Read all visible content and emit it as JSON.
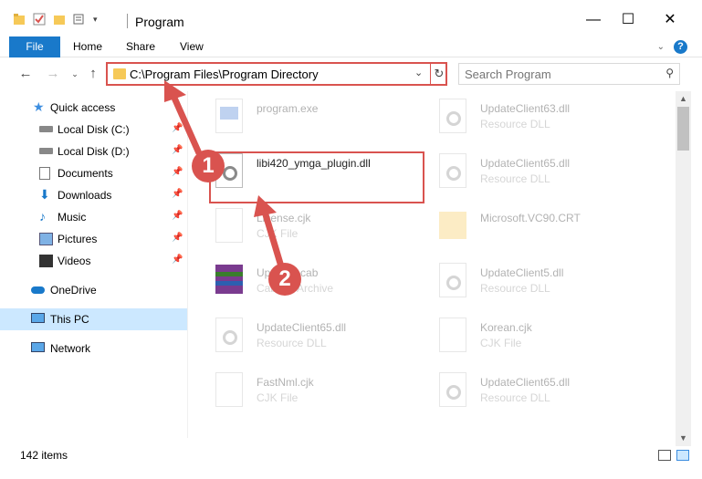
{
  "window": {
    "title": "Program",
    "minimize": "—",
    "maximize": "☐",
    "close": "✕"
  },
  "ribbon": {
    "tabs": [
      "File",
      "Home",
      "Share",
      "View"
    ],
    "help": "?"
  },
  "address": {
    "path": "C:\\Program Files\\Program Directory"
  },
  "search": {
    "placeholder": "Search Program"
  },
  "sidebar": {
    "items": [
      {
        "label": "Quick access",
        "icon": "star-icon",
        "pinned": false
      },
      {
        "label": "Local Disk (C:)",
        "icon": "drive-icon",
        "pinned": true
      },
      {
        "label": "Local Disk (D:)",
        "icon": "drive-icon",
        "pinned": true
      },
      {
        "label": "Documents",
        "icon": "documents-icon",
        "pinned": true
      },
      {
        "label": "Downloads",
        "icon": "downloads-icon",
        "pinned": true
      },
      {
        "label": "Music",
        "icon": "music-icon",
        "pinned": true
      },
      {
        "label": "Pictures",
        "icon": "pictures-icon",
        "pinned": true
      },
      {
        "label": "Videos",
        "icon": "videos-icon",
        "pinned": true
      },
      {
        "label": "OneDrive",
        "icon": "cloud-icon",
        "pinned": false
      },
      {
        "label": "This PC",
        "icon": "computer-icon",
        "pinned": false,
        "selected": true
      },
      {
        "label": "Network",
        "icon": "network-icon",
        "pinned": false
      }
    ]
  },
  "files": [
    {
      "name": "program.exe",
      "type": "",
      "icon": "exe-icon",
      "faded": true
    },
    {
      "name": "UpdateClient63.dll",
      "type": "Resource DLL",
      "icon": "dll-icon",
      "faded": true
    },
    {
      "name": "libi420_ymga_plugin.dll",
      "type": "",
      "icon": "dll-icon",
      "faded": false
    },
    {
      "name": "UpdateClient65.dll",
      "type": "Resource DLL",
      "icon": "dll-icon",
      "faded": true
    },
    {
      "name": "License.cjk",
      "type": "CJK File",
      "icon": "file-icon",
      "faded": true
    },
    {
      "name": "Microsoft.VC90.CRT",
      "type": "",
      "icon": "folder-icon",
      "faded": true
    },
    {
      "name": "Updates.cab",
      "type": "Cabinet Archive",
      "icon": "archive-icon",
      "faded": true
    },
    {
      "name": "UpdateClient5.dll",
      "type": "Resource DLL",
      "icon": "dll-icon",
      "faded": true
    },
    {
      "name": "UpdateClient65.dll",
      "type": "Resource DLL",
      "icon": "dll-icon",
      "faded": true
    },
    {
      "name": "Korean.cjk",
      "type": "CJK File",
      "icon": "file-icon",
      "faded": true
    },
    {
      "name": "FastNml.cjk",
      "type": "CJK File",
      "icon": "file-icon",
      "faded": true
    },
    {
      "name": "UpdateClient65.dll",
      "type": "Resource DLL",
      "icon": "dll-icon",
      "faded": true
    }
  ],
  "status": {
    "count": "142 items"
  },
  "annotations": {
    "step1": "1",
    "step2": "2",
    "color": "#d9534f"
  }
}
